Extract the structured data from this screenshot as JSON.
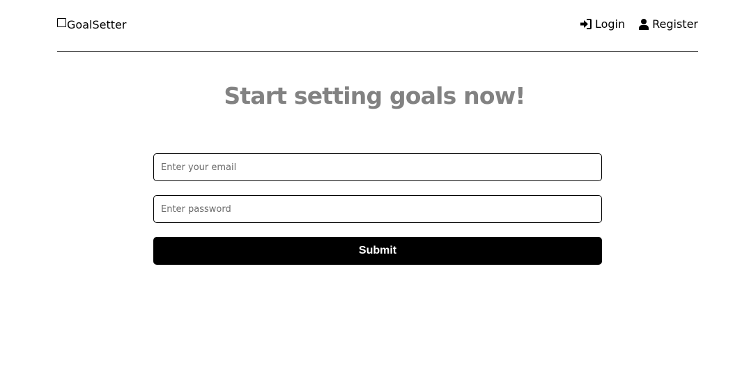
{
  "header": {
    "logo_text": "GoalSetter",
    "nav": {
      "login_label": "Login",
      "register_label": "Register"
    },
    "icons": {
      "logo": "square-icon",
      "login": "sign-in-icon",
      "register": "user-icon"
    }
  },
  "main": {
    "title": "Start setting goals now!",
    "email_placeholder": "Enter your email",
    "password_placeholder": "Enter password",
    "submit_label": "Submit"
  },
  "colors": {
    "title": "#828282",
    "button_bg": "#000000",
    "button_text": "#ffffff"
  }
}
